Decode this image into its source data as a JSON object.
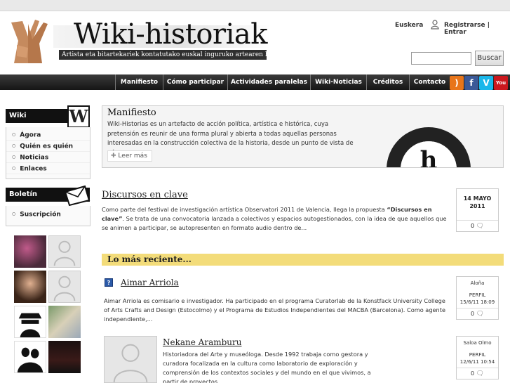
{
  "header": {
    "site_title": "Wiki-historiak",
    "tagline": "Artista eta bitartekariek kontatutako euskal inguruko artearen historiak",
    "language": "Euskera",
    "auth": "Registrarse | Entrar",
    "search_button": "Buscar",
    "search_value": ""
  },
  "nav": [
    "Manifiesto",
    "Cómo participar",
    "Actividades paralelas",
    "Wiki-Noticias",
    "Créditos",
    "Contacto"
  ],
  "social": [
    {
      "icon": "rss-icon",
      "color": "#e8751a",
      "glyph": ")"
    },
    {
      "icon": "facebook-icon",
      "color": "#3b5998",
      "glyph": "f"
    },
    {
      "icon": "vimeo-icon",
      "color": "#1ab7ea",
      "glyph": "V"
    },
    {
      "icon": "youtube-icon",
      "color": "#cc181e",
      "glyph": "You"
    }
  ],
  "sidebar": {
    "wiki": {
      "title": "Wiki",
      "badge": "W",
      "links": [
        "Ágora",
        "Quién es quién",
        "Noticias",
        "Enlaces"
      ]
    },
    "newsletter": {
      "title": "Boletín",
      "links": [
        "Suscripción"
      ]
    }
  },
  "feature": {
    "title": "Manifiesto",
    "text": "Wiki-Historias es un artefacto de acción política, artística e histórica, cuya pretensión es reunir de una forma plural y abierta a todas aquellas personas interesadas en la construcción colectiva de la historia, desde un punto de vista de género.",
    "more": "Leer más"
  },
  "article": {
    "title": "Discursos en clave",
    "text_before": "Como parte del festival de investigación artística Observatori 2011 de Valencia, llega la propuesta ",
    "text_bold": "“Discursos en clave”",
    "text_after": ". Se trata de una convocatoria lanzada a colectivos y espacios autogestionados, con la idea de que aquellos que se animen a participar, se autopresenten en formato audio dentro de...",
    "date_line1": "14 MAYO",
    "date_line2": "2011",
    "comments": "0"
  },
  "recent": {
    "heading": "Lo más reciente...",
    "items": [
      {
        "name": "Aimar Arriola",
        "text": "Aimar Arriola es comisario e investigador. Ha participado en el programa Curatorlab de la Konstfack University College of Arts Crafts and Design (Estocolmo) y el Programa de Estudios Independientes del MACBA (Barcelona). Como agente independiente,...",
        "author": "Aloña",
        "type": "PERFIL",
        "date": "15/6/11 18:09",
        "comments": "0"
      },
      {
        "name": "Nekane Aramburu",
        "text": "Historiadora del Arte y museóloga. Desde 1992 trabaja como gestora y curadora focalizada en la cultura como laboratorio de exploración y comprensión de los contextos sociales y del mundo en el que vivimos, a partir de proyectos...",
        "author": "Saloa Olmo",
        "type": "PERFIL",
        "date": "12/6/11 10:54",
        "comments": "0"
      }
    ]
  }
}
